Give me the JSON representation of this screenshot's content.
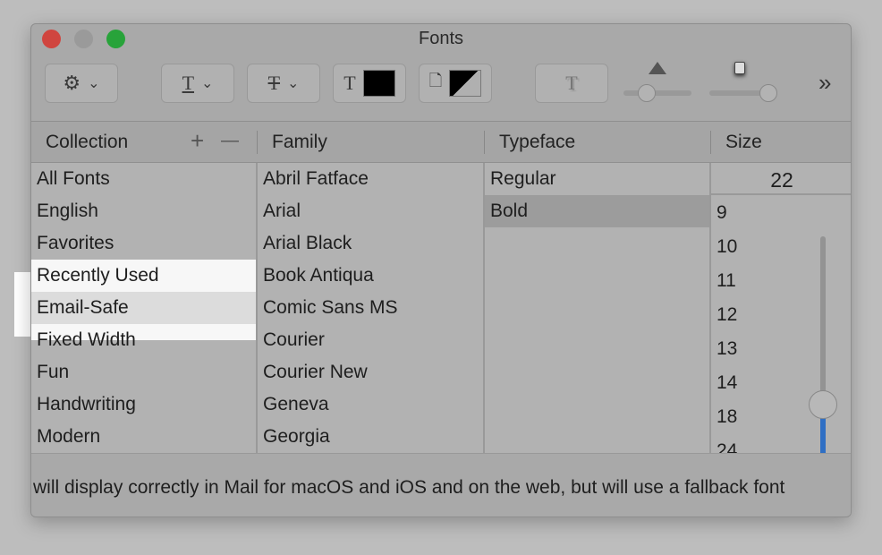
{
  "window": {
    "title": "Fonts"
  },
  "traffic_lights": {
    "close": "#d0453f",
    "minimize": "#9a9a9a",
    "zoom": "#28a33a"
  },
  "toolbar": {
    "action_icon": "gear-icon",
    "text_underline_icon": "T-underline",
    "strikethrough_icon": "T-strikethrough",
    "text_color": "#000000",
    "document_color": "black/white",
    "shadow_icon": "T-shadow",
    "shadow_opacity_slider": 0.2,
    "shadow_blur_slider": 1.0,
    "overflow_label": "»"
  },
  "headers": {
    "collection": "Collection",
    "add": "+",
    "remove": "—",
    "family": "Family",
    "typeface": "Typeface",
    "size": "Size"
  },
  "collections": [
    "All Fonts",
    "English",
    "Favorites",
    "Recently Used",
    "Email-Safe",
    "Fixed Width",
    "Fun",
    "Handwriting",
    "Modern"
  ],
  "selected_collection": "Email-Safe",
  "families": [
    "Abril Fatface",
    "Arial",
    "Arial Black",
    "Book Antiqua",
    "Comic Sans MS",
    "Courier",
    "Courier New",
    "Geneva",
    "Georgia"
  ],
  "typefaces": [
    "Regular",
    "Bold"
  ],
  "selected_typeface": "Bold",
  "size": {
    "value": "22",
    "options": [
      "9",
      "10",
      "11",
      "12",
      "13",
      "14",
      "18",
      "24"
    ],
    "slider_value": 22,
    "accent": "#2f6fc4"
  },
  "footer": {
    "text": "will display correctly in Mail for macOS and iOS and on the web, but will use a fallback font"
  }
}
